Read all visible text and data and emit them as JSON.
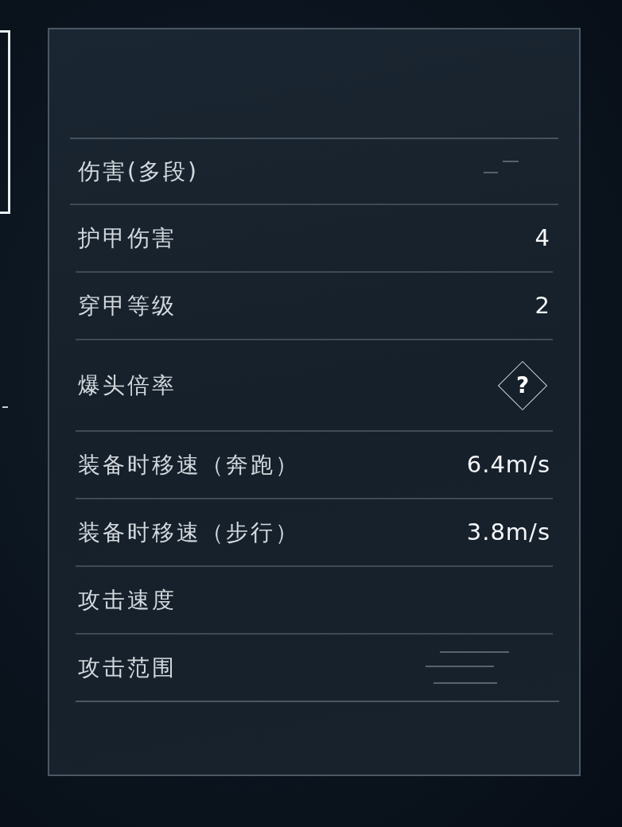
{
  "stats": [
    {
      "label": "伤害(多段)",
      "kind": "marks"
    },
    {
      "label": "护甲伤害",
      "kind": "text",
      "value": "4"
    },
    {
      "label": "穿甲等级",
      "kind": "text",
      "value": "2"
    },
    {
      "label": "爆头倍率",
      "kind": "unknown",
      "value": "?"
    },
    {
      "label": "装备时移速（奔跑）",
      "kind": "text",
      "value": "6.4m/s"
    },
    {
      "label": "装备时移速（步行）",
      "kind": "text",
      "value": "3.8m/s"
    },
    {
      "label": "攻击速度",
      "kind": "blank"
    },
    {
      "label": "攻击范围",
      "kind": "lines"
    }
  ]
}
